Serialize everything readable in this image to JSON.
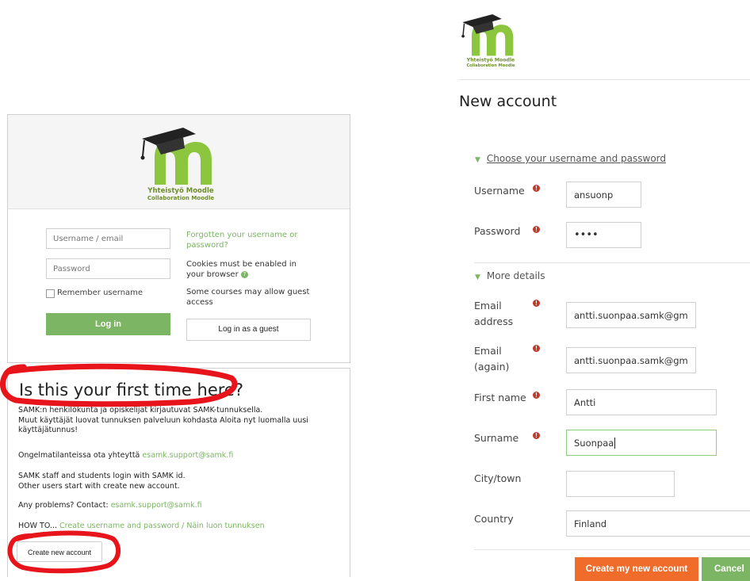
{
  "login": {
    "logo_line1": "Yhteistyö Moodle",
    "logo_line2": "Collaboration Moodle",
    "username_placeholder": "Username / email",
    "password_placeholder": "Password",
    "remember_label": "Remember username",
    "login_button": "Log in",
    "forgot_link": "Forgotten your username or password?",
    "cookies_text": "Cookies must be enabled in your browser",
    "guest_text": "Some courses may allow guest access",
    "guest_button": "Log in as a guest"
  },
  "first_time": {
    "title": "Is this your first time here?",
    "para1_line1": "SAMK:n henkilökunta ja opiskelijat kirjautuvat SAMK-tunnuksella.",
    "para1_line2": "Muut käyttäjät luovat tunnuksen palveluun kohdasta Aloita nyt luomalla uusi",
    "para1_line3": "käyttäjätunnus!",
    "problems_fi": "Ongelmatilanteissa ota yhteyttä",
    "email": "esamk.support@samk.fi",
    "staff_line1": "SAMK staff and students login with SAMK id.",
    "staff_line2": "Other users start with create new account.",
    "problems_en": "Any problems? Contact:",
    "howto_label": "HOW TO...",
    "howto_link": "Create username and password / Näin luon tunnuksen",
    "create_button": "Create new account"
  },
  "signup": {
    "logo_line1": "Yhteistyö Moodle",
    "logo_line2": "Collaboration Moodle",
    "title": "New account",
    "section1": "Choose your username and password",
    "section2": "More details",
    "required_icon": "!",
    "fields": {
      "username_label": "Username",
      "username_value": "ansuonp",
      "password_label": "Password",
      "password_value": "••••",
      "email_label_1": "Email",
      "email_label_2": "address",
      "email_value": "antti.suonpaa.samk@gm",
      "email2_label_1": "Email",
      "email2_label_2": "(again)",
      "email2_value": "antti.suonpaa.samk@gm",
      "firstname_label": "First name",
      "firstname_value": "Antti",
      "surname_label": "Surname",
      "surname_value": "Suonpaa",
      "city_label": "City/town",
      "city_value": "",
      "country_label": "Country",
      "country_value": "Finland"
    },
    "submit_button": "Create my new account",
    "cancel_button": "Cancel"
  },
  "colors": {
    "brand_green": "#7cb563",
    "orange": "#ef6c2a",
    "annotation_red": "#e8141b"
  }
}
